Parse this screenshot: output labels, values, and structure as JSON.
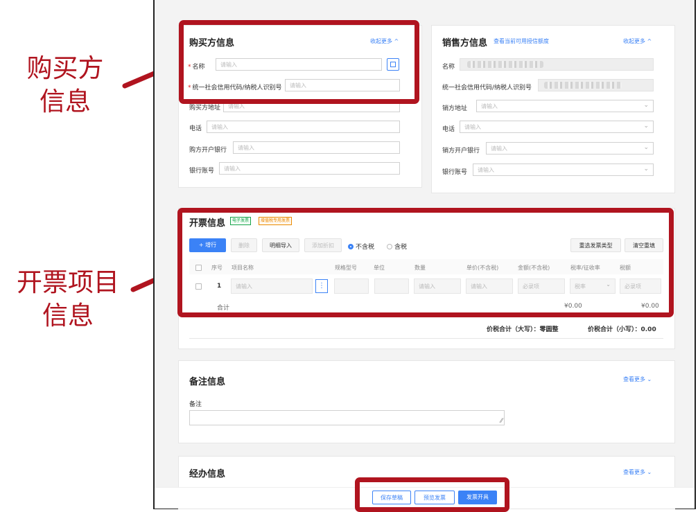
{
  "annotations": {
    "buyer_label_line1": "购买方",
    "buyer_label_line2": "信息",
    "items_label_line1": "开票项目",
    "items_label_line2": "信息",
    "highlight_color": "#b0141f"
  },
  "buyer": {
    "title": "购买方信息",
    "collapse_link": "收起更多 ^",
    "fields": [
      {
        "label": "名称",
        "required": true,
        "placeholder": "请输入"
      },
      {
        "label": "统一社会信用代码/纳税人识别号",
        "required": true,
        "placeholder": "请输入"
      },
      {
        "label": "购买方地址",
        "required": false,
        "placeholder": "请输入"
      },
      {
        "label": "电话",
        "required": false,
        "placeholder": "请输入"
      },
      {
        "label": "购方开户银行",
        "required": false,
        "placeholder": "请输入"
      },
      {
        "label": "银行账号",
        "required": false,
        "placeholder": "请输入"
      }
    ]
  },
  "seller": {
    "title": "销售方信息",
    "credit_link": "查看当前可用授信额度",
    "collapse_link": "收起更多 ^",
    "fields": [
      {
        "label": "名称",
        "placeholder": ""
      },
      {
        "label": "统一社会信用代码/纳税人识别号",
        "placeholder": ""
      },
      {
        "label": "销方地址",
        "placeholder": "请输入"
      },
      {
        "label": "电话",
        "placeholder": "请输入"
      },
      {
        "label": "销方开户银行",
        "placeholder": "请输入"
      },
      {
        "label": "银行账号",
        "placeholder": "请输入"
      }
    ]
  },
  "invoice": {
    "title": "开票信息",
    "tag_electronic": "电子发票",
    "tag_special": "增值税专用发票",
    "buttons": {
      "add_row": "+ 增行",
      "delete": "删除",
      "import_details": "明细导入",
      "add_discount": "添加折扣",
      "reselect_type": "重选发票类型",
      "clear": "清空重填"
    },
    "tax_options": {
      "exclusive": "不含税",
      "inclusive": "含税"
    },
    "columns": [
      "序号",
      "项目名称",
      "规格型号",
      "单位",
      "数量",
      "单价(不含税)",
      "金额(不含税)",
      "税率/征收率",
      "税额"
    ],
    "row": {
      "index": "1",
      "name_placeholder": "请输入",
      "qty_placeholder": "请输入",
      "price_placeholder": "请输入",
      "amount_placeholder": "必录项",
      "rate_placeholder": "税率",
      "tax_placeholder": "必录项"
    },
    "subtotal_label": "合计",
    "subtotal_amount": "¥0.00",
    "subtotal_tax": "¥0.00",
    "total_upper": "价税合计（大写）：零圆整",
    "total_lower": "价税合计（小写）：0.00"
  },
  "remarks": {
    "title": "备注信息",
    "more_link": "查看更多 ⌄",
    "field_label": "备注"
  },
  "handler": {
    "title": "经办信息",
    "more_link": "查看更多 ⌄"
  },
  "footer": {
    "save_draft": "保存草稿",
    "preview": "预览发票",
    "issue": "发票开具"
  }
}
